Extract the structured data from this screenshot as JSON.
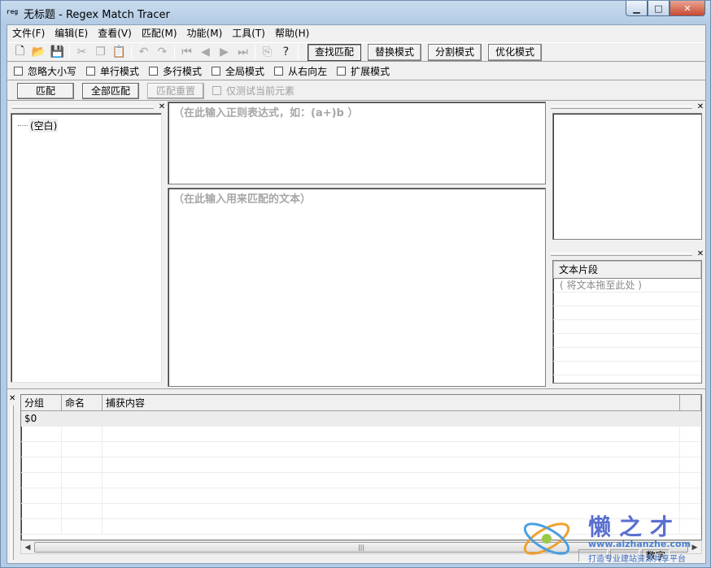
{
  "window": {
    "title": "无标题 - Regex Match Tracer",
    "app_icon": "reg",
    "controls": [
      "minimize-icon",
      "maximize-icon",
      "close-icon"
    ]
  },
  "menu": [
    "文件(F)",
    "编辑(E)",
    "查看(V)",
    "匹配(M)",
    "功能(M)",
    "工具(T)",
    "帮助(H)"
  ],
  "toolbar": {
    "icons": [
      "new-file-icon",
      "open-folder-icon",
      "save-icon",
      "cut-icon",
      "copy-icon",
      "paste-icon",
      "undo-icon",
      "redo-icon",
      "first-icon",
      "prev-icon",
      "next-icon",
      "last-icon",
      "copy-match-icon",
      "help-icon"
    ],
    "modes": [
      "查找匹配",
      "替换模式",
      "分割模式",
      "优化模式"
    ],
    "active_mode": "查找匹配"
  },
  "options": [
    "忽略大小写",
    "单行模式",
    "多行模式",
    "全局模式",
    "从右向左",
    "扩展模式"
  ],
  "actions": {
    "match": "匹配",
    "match_all": "全部匹配",
    "reset": "匹配重置",
    "test_current": "仅测试当前元素"
  },
  "tree": {
    "item": "(空白)"
  },
  "regex_placeholder": "（在此输入正则表达式，如：(a+)b ）",
  "text_placeholder": "（在此输入用来匹配的文本）",
  "snippets": {
    "header": "文本片段",
    "hint": "( 将文本拖至此处 )"
  },
  "results": {
    "columns": [
      "分组",
      "命名",
      "捕获内容"
    ],
    "rows": [
      {
        "group": "$0",
        "name": "",
        "content": ""
      }
    ]
  },
  "statusbar": {
    "mode": "数字"
  },
  "watermark": {
    "title": "懒之才",
    "url": "www.aizhanzhe.com",
    "slogan": "打造专业建站资源共享平台"
  },
  "colors": {
    "title_bar": "#b3cbe4",
    "placeholder": "#a6a6a6",
    "watermark": "#5a6fd0"
  }
}
